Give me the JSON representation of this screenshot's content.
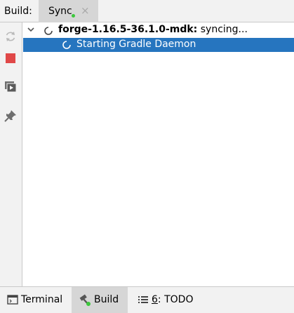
{
  "header": {
    "build_label": "Build:",
    "tab_sync_label": "Sync",
    "tab_close_glyph": "×",
    "tab_status_color": "#3cc83c"
  },
  "sidebar": {
    "icons": [
      "refresh-icon",
      "stop-icon",
      "console-icon",
      "pin-icon"
    ],
    "stop_color": "#e04848"
  },
  "tree": {
    "root": {
      "project": "forge-1.16.5-36.1.0-mdk:",
      "status": " syncing..."
    },
    "child": {
      "label": "Starting Gradle Daemon",
      "selected_color": "#2675bf"
    }
  },
  "bottom_tabs": [
    {
      "label": "Terminal",
      "icon": "terminal-icon"
    },
    {
      "label": "Build",
      "icon": "hammer-icon",
      "active": true
    },
    {
      "mnemonic": "6",
      "rest": ": TODO",
      "icon": "list-icon"
    }
  ]
}
